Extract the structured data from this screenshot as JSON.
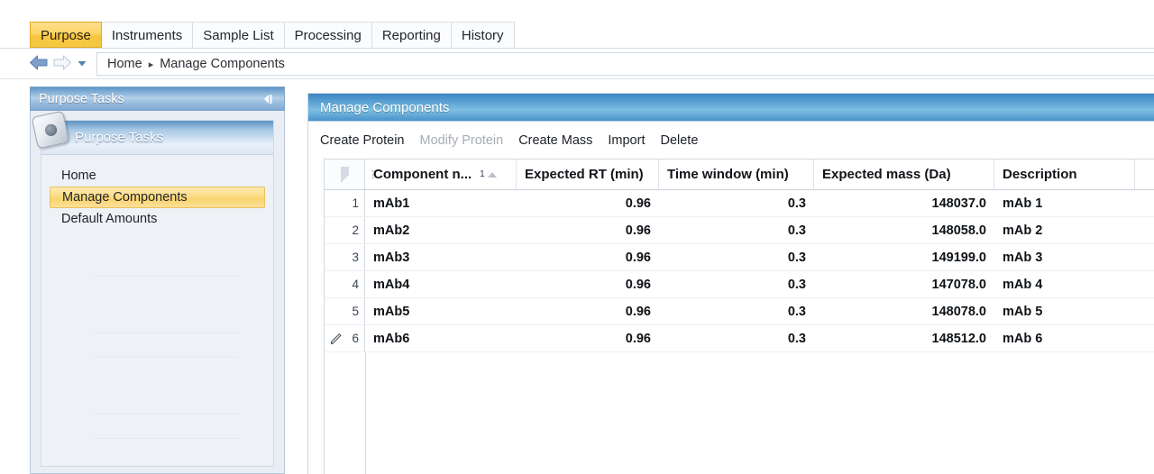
{
  "tabs": [
    {
      "label": "Purpose",
      "active": true
    },
    {
      "label": "Instruments",
      "active": false
    },
    {
      "label": "Sample List",
      "active": false
    },
    {
      "label": "Processing",
      "active": false
    },
    {
      "label": "Reporting",
      "active": false
    },
    {
      "label": "History",
      "active": false
    }
  ],
  "nav": {
    "back_icon": "back-arrow-icon",
    "forward_icon": "forward-arrow-icon",
    "dropdown_icon": "chevron-down-icon"
  },
  "breadcrumb": {
    "items": [
      "Home",
      "Manage Components"
    ],
    "separator": "▸"
  },
  "sidebar": {
    "title": "Purpose Tasks",
    "collapse_icon": "collapse-left-icon",
    "group_title": "Purpose Tasks",
    "group_icon": "purpose-tasks-icon",
    "items": [
      {
        "label": "Home",
        "selected": false
      },
      {
        "label": "Manage Components",
        "selected": true
      },
      {
        "label": "Default Amounts",
        "selected": false
      }
    ]
  },
  "content": {
    "title": "Manage Components",
    "toolbar": [
      {
        "label": "Create Protein",
        "disabled": false
      },
      {
        "label": "Modify Protein",
        "disabled": true
      },
      {
        "label": "Create Mass",
        "disabled": false
      },
      {
        "label": "Import",
        "disabled": false
      },
      {
        "label": "Delete",
        "disabled": false
      }
    ],
    "grid": {
      "row_header_icon": "select-all-triangle-icon",
      "columns": [
        {
          "label": "Component n...",
          "sort_index": "1",
          "sort_dir": "asc"
        },
        {
          "label": "Expected RT (min)"
        },
        {
          "label": "Time window (min)"
        },
        {
          "label": "Expected mass (Da)"
        },
        {
          "label": "Description"
        }
      ],
      "rows": [
        {
          "n": "1",
          "editing": false,
          "name": "mAb1",
          "rt": "0.96",
          "tw": "0.3",
          "mass": "148037.0",
          "desc": "mAb 1"
        },
        {
          "n": "2",
          "editing": false,
          "name": "mAb2",
          "rt": "0.96",
          "tw": "0.3",
          "mass": "148058.0",
          "desc": "mAb 2"
        },
        {
          "n": "3",
          "editing": false,
          "name": "mAb3",
          "rt": "0.96",
          "tw": "0.3",
          "mass": "149199.0",
          "desc": "mAb 3"
        },
        {
          "n": "4",
          "editing": false,
          "name": "mAb4",
          "rt": "0.96",
          "tw": "0.3",
          "mass": "147078.0",
          "desc": "mAb 4"
        },
        {
          "n": "5",
          "editing": false,
          "name": "mAb5",
          "rt": "0.96",
          "tw": "0.3",
          "mass": "148078.0",
          "desc": "mAb 5"
        },
        {
          "n": "6",
          "editing": true,
          "name": "mAb6",
          "rt": "0.96",
          "tw": "0.3",
          "mass": "148512.0",
          "desc": "mAb 6"
        }
      ]
    }
  },
  "colors": {
    "active_tab": "#f7c63f",
    "selection_highlight": "#f9d46d",
    "panel_header_blue": "#5d93c6",
    "content_header_blue": "#63a8d6"
  }
}
